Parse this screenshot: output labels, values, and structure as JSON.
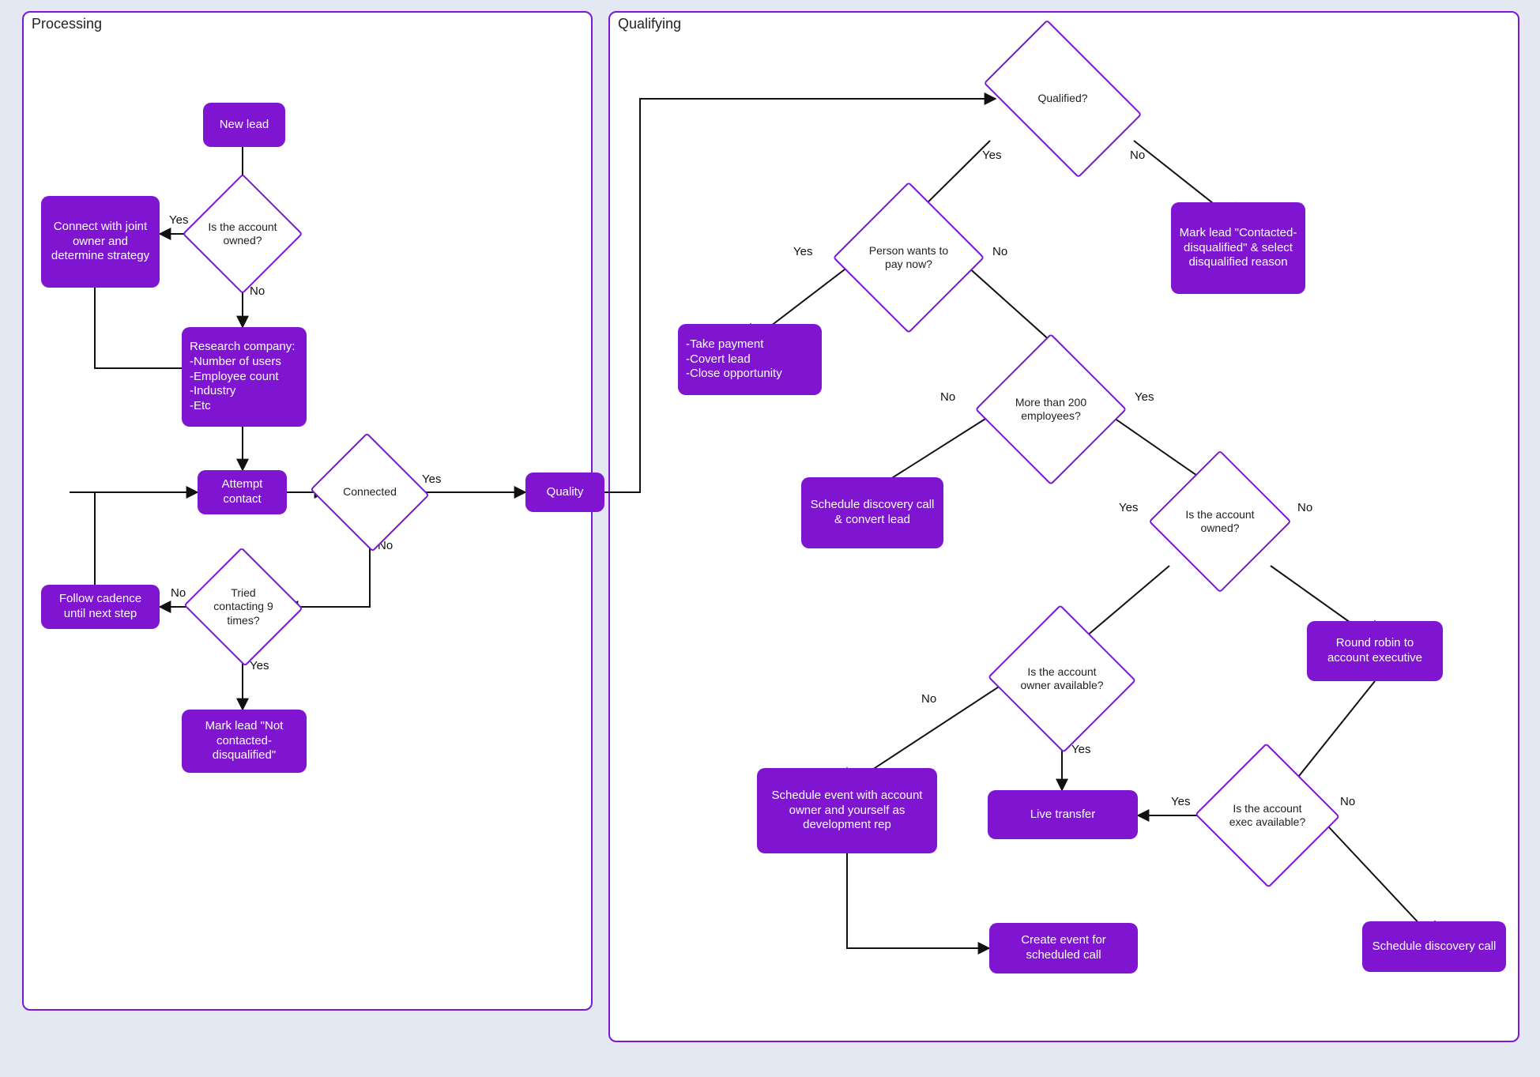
{
  "lanes": {
    "processing": {
      "title": "Processing"
    },
    "qualifying": {
      "title": "Qualifying"
    }
  },
  "nodes": {
    "new_lead": {
      "label": "New lead"
    },
    "is_account_owned_1": {
      "label": "Is the account owned?"
    },
    "connect_strategy": {
      "label": "Connect with joint owner and determine strategy"
    },
    "research_company": {
      "label": "Research company:\n-Number of users\n-Employee count\n-Industry\n-Etc"
    },
    "attempt_contact": {
      "label": "Attempt contact"
    },
    "connected": {
      "label": "Connected"
    },
    "tried_9_times": {
      "label": "Tried contacting 9 times?"
    },
    "follow_cadence": {
      "label": "Follow cadence until next step"
    },
    "mark_not_contacted": {
      "label": "Mark lead \"Not contacted-disqualified\""
    },
    "quality": {
      "label": "Quality"
    },
    "qualified": {
      "label": "Qualified?"
    },
    "mark_disqualified": {
      "label": "Mark lead \"Contacted-disqualified\" & select disqualified reason"
    },
    "pay_now": {
      "label": "Person wants to pay now?"
    },
    "take_payment": {
      "label": "-Take payment\n-Covert lead\n-Close opportunity"
    },
    "more_than_200": {
      "label": "More than 200 employees?"
    },
    "schedule_discovery_convert": {
      "label": "Schedule discovery call & convert lead"
    },
    "is_account_owned_2": {
      "label": "Is the account owned?"
    },
    "round_robin": {
      "label": "Round robin to account executive"
    },
    "owner_available": {
      "label": "Is the account owner available?"
    },
    "schedule_event_owner": {
      "label": "Schedule event with account owner and yourself as development rep"
    },
    "live_transfer": {
      "label": "Live transfer"
    },
    "exec_available": {
      "label": "Is the account exec available?"
    },
    "create_event": {
      "label": "Create event for scheduled call"
    },
    "schedule_discovery": {
      "label": "Schedule discovery call"
    }
  },
  "labels": {
    "yes": "Yes",
    "no": "No"
  }
}
